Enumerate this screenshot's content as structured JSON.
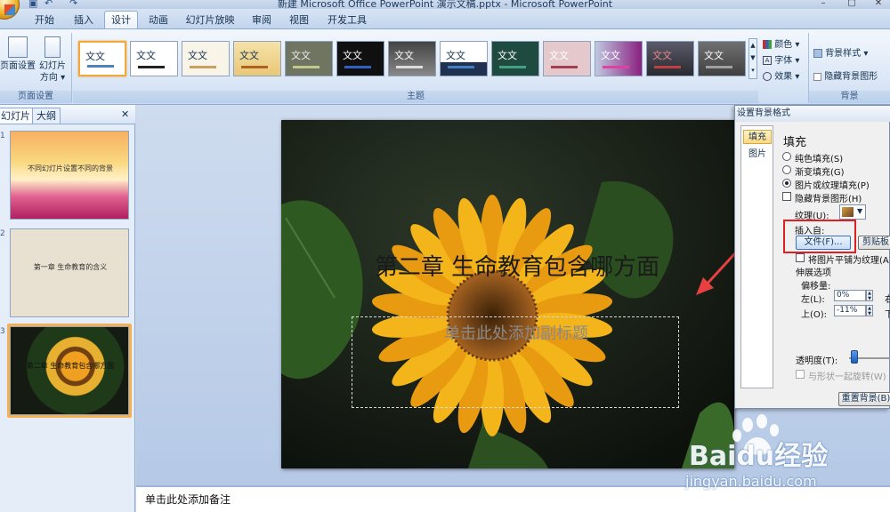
{
  "window": {
    "title": "新建 Microsoft Office PowerPoint 演示文稿.pptx - Microsoft PowerPoint",
    "controls": [
      "–",
      "▢",
      "✕"
    ]
  },
  "tabs": [
    {
      "label": "开始"
    },
    {
      "label": "插入"
    },
    {
      "label": "设计",
      "active": true
    },
    {
      "label": "动画"
    },
    {
      "label": "幻灯片放映"
    },
    {
      "label": "审阅"
    },
    {
      "label": "视图"
    },
    {
      "label": "开发工具"
    }
  ],
  "ribbon": {
    "page_setup": {
      "btn1": "页面设置",
      "btn2a": "幻灯片",
      "btn2b": "方向 ▾",
      "group": "页面设置"
    },
    "themes": {
      "group": "主题",
      "thumb_text": "文文",
      "count": 13
    },
    "theme_opts": {
      "colors": "颜色 ▾",
      "fonts": "字体 ▾",
      "effects": "效果 ▾"
    },
    "background": {
      "styles": "背景样式 ▾",
      "hide": "隐藏背景图形",
      "group": "背景"
    }
  },
  "left_panel": {
    "tab_slides": "幻灯片",
    "tab_outline": "大纲",
    "close": "✕",
    "slides": [
      {
        "num": "1",
        "title": "不同幻灯片设置不同的背景"
      },
      {
        "num": "2",
        "title": "第一章 生命教育的含义"
      },
      {
        "num": "3",
        "title": "第二章 生命教育包含哪方面"
      }
    ]
  },
  "slide": {
    "title": "第二章 生命教育包含哪方面",
    "subtitle": "单击此处添加副标题"
  },
  "notes": {
    "placeholder": "单击此处添加备注"
  },
  "dialog": {
    "title": "设置背景格式",
    "nav": [
      "填充",
      "图片"
    ],
    "heading": "填充",
    "options": {
      "solid": "纯色填充(S)",
      "gradient": "渐变填充(G)",
      "picture": "图片或纹理填充(P)",
      "hide_graphics": "隐藏背景图形(H)"
    },
    "texture_label": "纹理(U):",
    "insert_from": "插入自:",
    "file_btn": "文件(F)...",
    "clipboard_btn": "剪贴板",
    "tile": "将图片平铺为纹理(A)",
    "stretch": "伸展选项",
    "offset": "偏移量:",
    "left_label": "左(L):",
    "left_value": "0%",
    "right_label": "右",
    "top_label": "上(O):",
    "top_value": "-11%",
    "bottom_label": "下",
    "transparency": "透明度(T):",
    "rotate": "与形状一起旋转(W)",
    "reset_btn": "重置背景(B)"
  },
  "watermark": {
    "brand": "Baidu经验",
    "url": "jingyan.baidu.com"
  },
  "colors": {
    "accent": "#f2a93c",
    "highlight": "#e02020",
    "arrow": "#e84040"
  }
}
